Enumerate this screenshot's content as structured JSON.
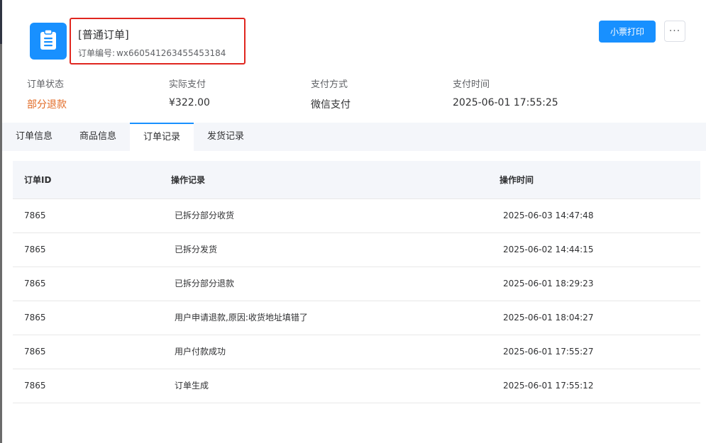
{
  "header": {
    "order_type": "[普通订单]",
    "order_no_label": "订单编号:",
    "order_no": "wx660541263455453184",
    "print_button": "小票打印",
    "more_button": "···",
    "icon": "clipboard-icon"
  },
  "summary": [
    {
      "key": "订单状态",
      "value": "部分退款"
    },
    {
      "key": "实际支付",
      "value": "¥322.00"
    },
    {
      "key": "支付方式",
      "value": "微信支付"
    },
    {
      "key": "支付时间",
      "value": "2025-06-01 17:55:25"
    }
  ],
  "tabs": [
    {
      "label": "订单信息"
    },
    {
      "label": "商品信息"
    },
    {
      "label": "订单记录"
    },
    {
      "label": "发货记录"
    }
  ],
  "active_tab": "订单记录",
  "table": {
    "columns": [
      "订单ID",
      "操作记录",
      "操作时间"
    ],
    "rows": [
      {
        "id": "7865",
        "action": "已拆分部分收货",
        "time": "2025-06-03 14:47:48"
      },
      {
        "id": "7865",
        "action": "已拆分发货",
        "time": "2025-06-02 14:44:15"
      },
      {
        "id": "7865",
        "action": "已拆分部分退款",
        "time": "2025-06-01 18:29:23"
      },
      {
        "id": "7865",
        "action": "用户申请退款,原因:收货地址填错了",
        "time": "2025-06-01 18:04:27"
      },
      {
        "id": "7865",
        "action": "用户付款成功",
        "time": "2025-06-01 17:55:27"
      },
      {
        "id": "7865",
        "action": "订单生成",
        "time": "2025-06-01 17:55:12"
      }
    ]
  },
  "colors": {
    "primary": "#1890ff",
    "status_warn": "#e26a24",
    "highlight_border": "#e0261f"
  }
}
